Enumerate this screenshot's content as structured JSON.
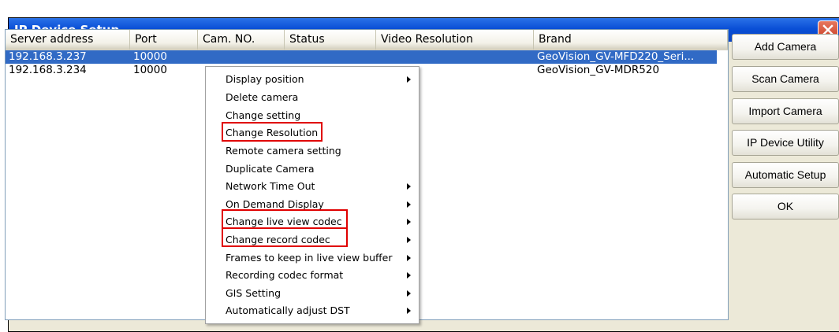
{
  "window": {
    "title": "IP Device Setup"
  },
  "table": {
    "columns": [
      "Server address",
      "Port",
      "Cam. NO.",
      "Status",
      "Video Resolution",
      "Brand"
    ],
    "rows": [
      {
        "server": "192.168.3.237",
        "port": "10000",
        "brand": "GeoVision_GV-MFD220_Seri...",
        "selected": true
      },
      {
        "server": "192.168.3.234",
        "port": "10000",
        "brand": "GeoVision_GV-MDR520",
        "selected": false
      }
    ]
  },
  "side_buttons": [
    "Add Camera",
    "Scan Camera",
    "Import Camera",
    "IP Device Utility",
    "Automatic Setup",
    "OK"
  ],
  "context_menu": {
    "items": [
      {
        "label": "Display position",
        "submenu": true
      },
      {
        "label": "Delete camera",
        "submenu": false
      },
      {
        "label": "Change setting",
        "submenu": false
      },
      {
        "label": "Change Resolution",
        "submenu": false,
        "highlighted": true
      },
      {
        "label": "Remote camera setting",
        "submenu": false
      },
      {
        "label": "Duplicate Camera",
        "submenu": false
      },
      {
        "label": "Network Time Out",
        "submenu": true
      },
      {
        "label": "On Demand Display",
        "submenu": true
      },
      {
        "label": "Change live view codec",
        "submenu": true,
        "highlighted": true
      },
      {
        "label": "Change record codec",
        "submenu": true,
        "highlighted": true
      },
      {
        "label": "Frames to keep in live view buffer",
        "submenu": true
      },
      {
        "label": "Recording codec format",
        "submenu": true
      },
      {
        "label": "GIS Setting",
        "submenu": true
      },
      {
        "label": "Automatically adjust DST",
        "submenu": true
      }
    ]
  },
  "colors": {
    "selection": "#316ac5",
    "titlebar": "#0a4fd6",
    "annotation": "#e00000"
  }
}
